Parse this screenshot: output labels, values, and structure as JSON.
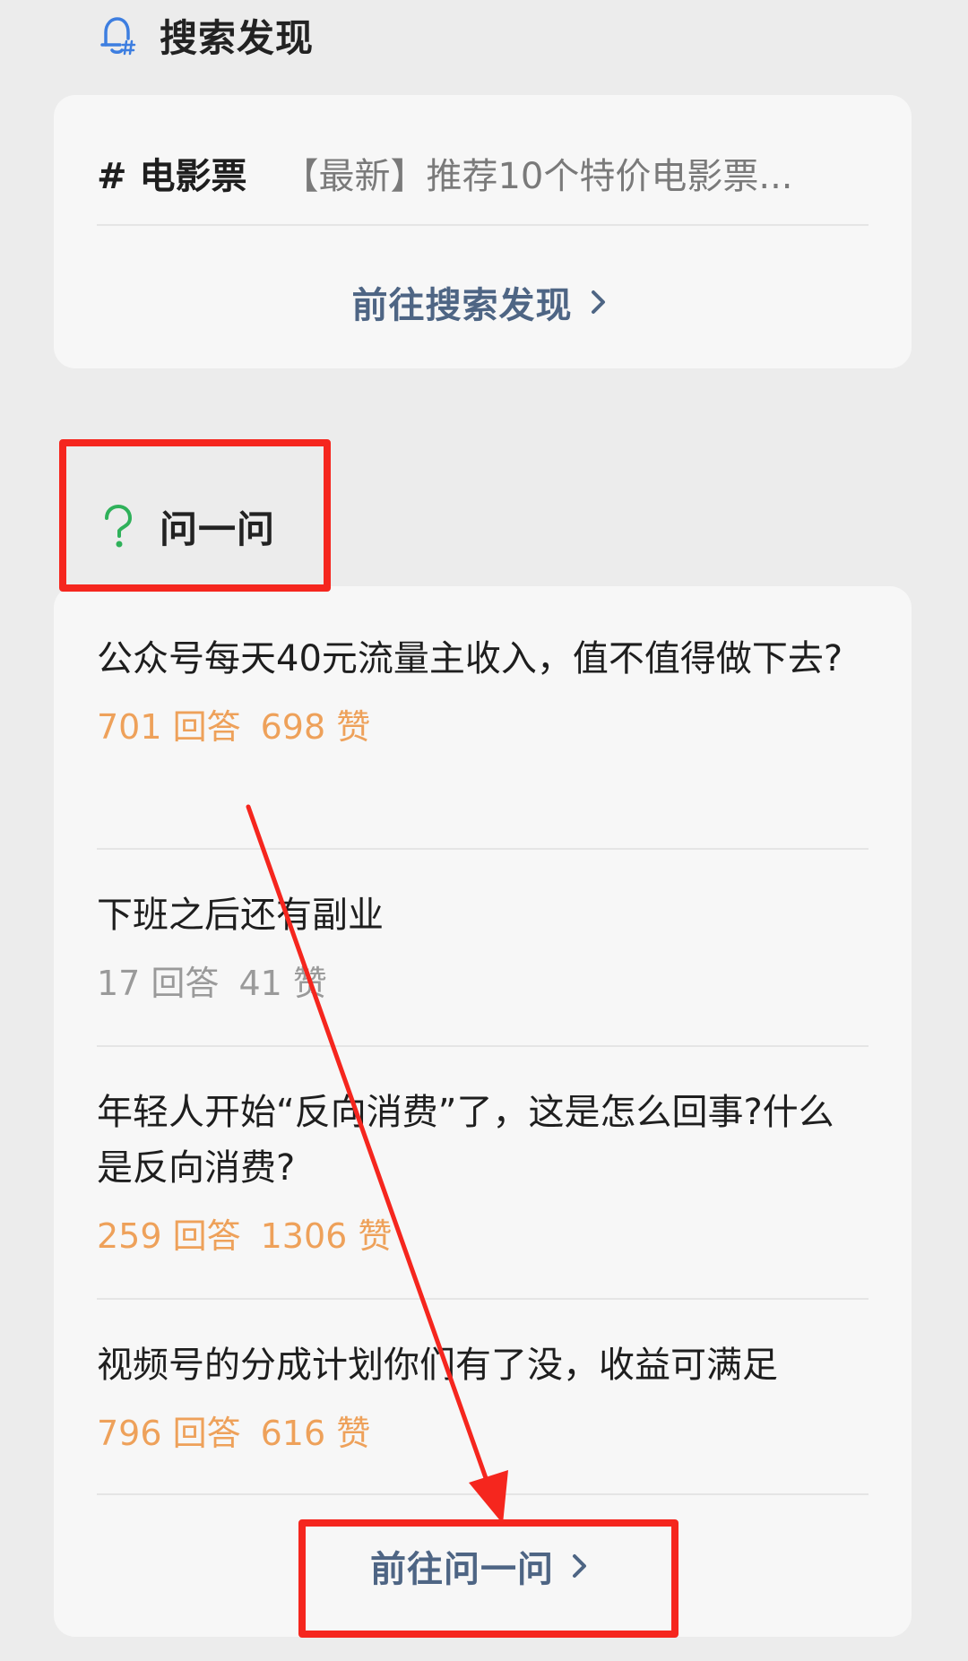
{
  "search_discover": {
    "title": "搜索发现",
    "icon": "bell-hash-icon",
    "topic_tag": "# 电影票",
    "topic_desc": "【最新】推荐10个特价电影票...",
    "goto_label": "前往搜索发现"
  },
  "ask": {
    "title": "问一问",
    "icon": "question-icon",
    "questions": [
      {
        "title": "公众号每天40元流量主收入，值不值得做下去?",
        "answers": "701 回答",
        "likes": "698 赞",
        "stats_color": "orange"
      },
      {
        "title": "下班之后还有副业",
        "answers": "17 回答",
        "likes": "41 赞",
        "stats_color": "gray"
      },
      {
        "title": "年轻人开始“反向消费”了，这是怎么回事?什么是反向消费?",
        "answers": "259 回答",
        "likes": "1306 赞",
        "stats_color": "orange"
      },
      {
        "title": "视频号的分成计划你们有了没，收益可满足",
        "answers": "796 回答",
        "likes": "616 赞",
        "stats_color": "orange"
      }
    ],
    "goto_label": "前往问一问"
  },
  "colors": {
    "background": "#ececec",
    "card": "#f7f7f7",
    "link": "#4e6584",
    "stats_orange": "#eea15a",
    "stats_gray": "#9a9a9a",
    "question_green": "#2fb15a",
    "bell_blue": "#3d7ee0",
    "annotation_red": "#f5261e"
  }
}
